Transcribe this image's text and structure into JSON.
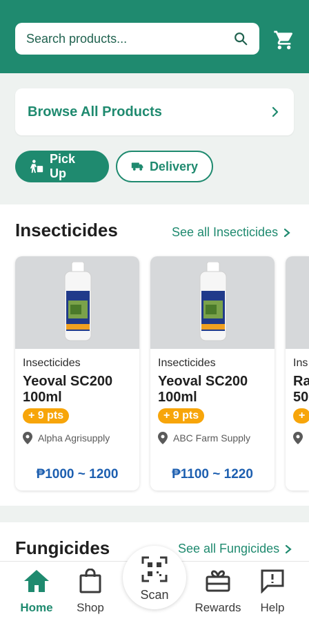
{
  "header": {
    "search_placeholder": "Search products...",
    "search_icon": "search-icon",
    "cart_icon": "cart-icon"
  },
  "browse": {
    "label": "Browse All Products"
  },
  "fulfillment": {
    "pickup": "Pick Up",
    "delivery": "Delivery"
  },
  "insecticides": {
    "title": "Insecticides",
    "see_all": "See all Insecticides",
    "products": [
      {
        "category": "Insecticides",
        "name": "Yeoval SC200 100ml",
        "points": "+ 9 pts",
        "store": "Alpha Agrisupply",
        "price": "₱1000 ~ 1200"
      },
      {
        "category": "Insecticides",
        "name": "Yeoval SC200 100ml",
        "points": "+ 9 pts",
        "store": "ABC Farm Supply",
        "price": "₱1100 ~ 1220"
      },
      {
        "category": "Ins",
        "name": "Ra 50",
        "points": "+",
        "store": "",
        "price": ""
      }
    ]
  },
  "fungicides": {
    "title": "Fungicides",
    "see_all": "See all Fungicides"
  },
  "nav": {
    "home": "Home",
    "shop": "Shop",
    "scan": "Scan",
    "rewards": "Rewards",
    "help": "Help"
  },
  "colors": {
    "brand": "#1f8a6f",
    "points_badge": "#f7a50a",
    "price": "#1d5fb0"
  }
}
